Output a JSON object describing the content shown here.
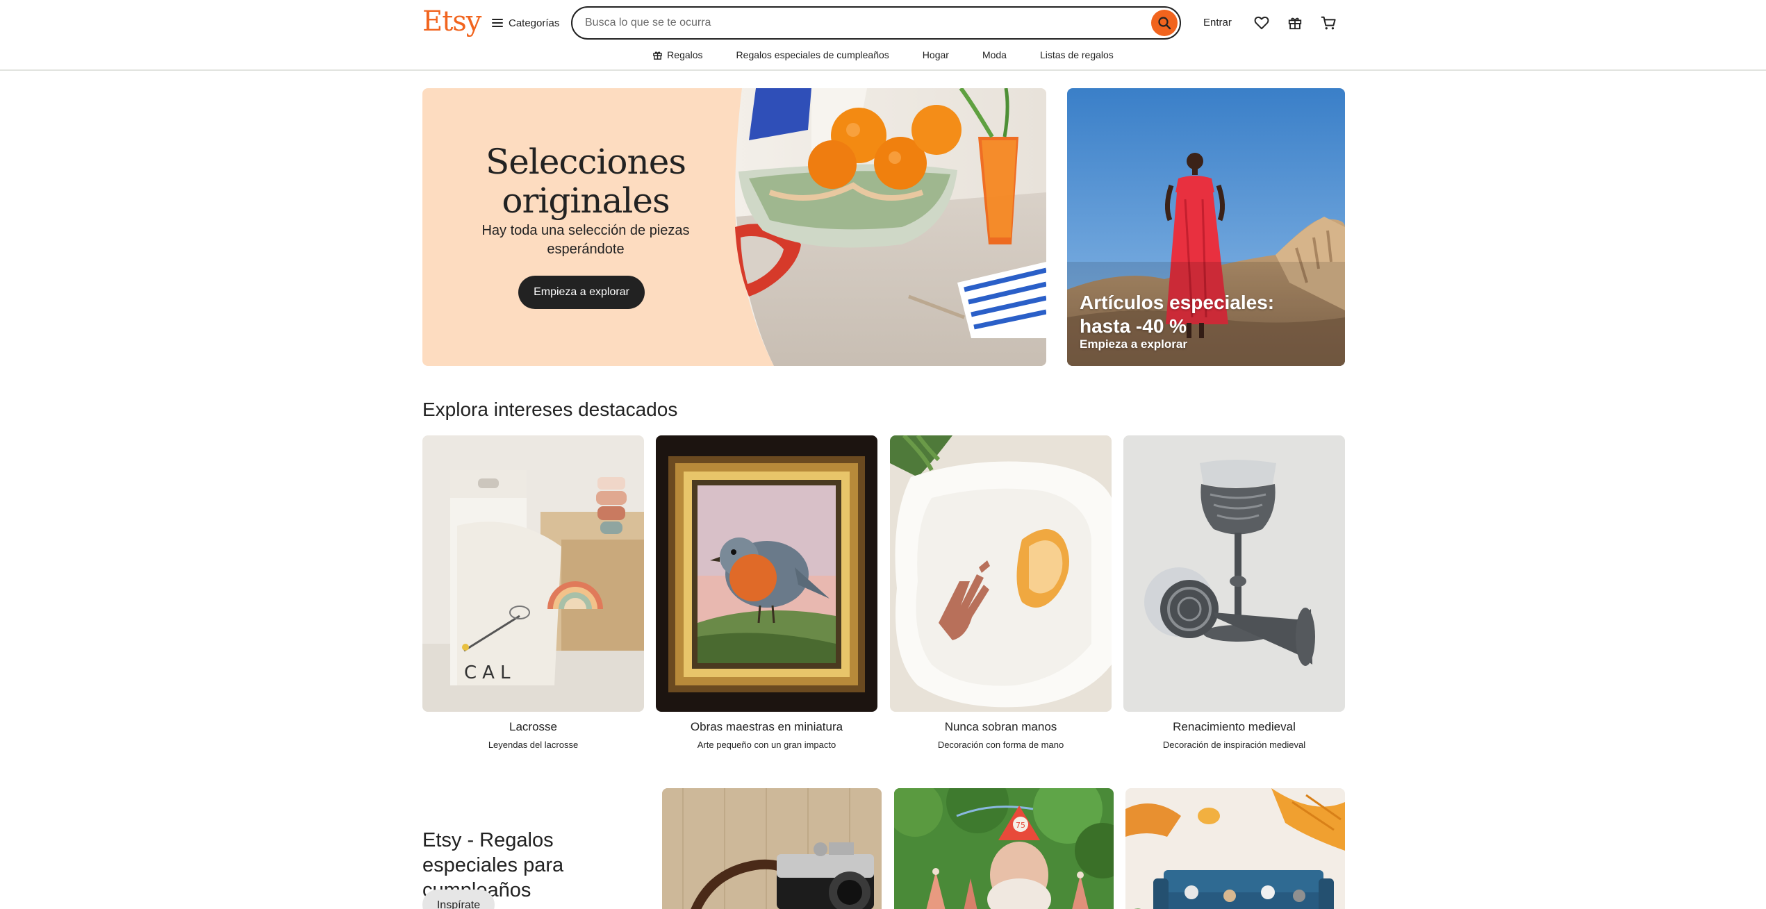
{
  "header": {
    "logo": "Etsy",
    "categories_label": "Categorías",
    "search_placeholder": "Busca lo que se te ocurra",
    "signin_label": "Entrar",
    "icons": [
      "menu-icon",
      "search-icon",
      "heart-icon",
      "gift-icon",
      "cart-icon"
    ]
  },
  "subnav": {
    "items": [
      {
        "label": "Regalos",
        "icon": "gift-icon"
      },
      {
        "label": "Regalos especiales de cumpleaños"
      },
      {
        "label": "Hogar"
      },
      {
        "label": "Moda"
      },
      {
        "label": "Listas de regalos"
      }
    ]
  },
  "hero": {
    "title": "Selecciones originales",
    "subtitle": "Hay toda una selección de piezas esperándote",
    "button_label": "Empieza a explorar"
  },
  "side_promo": {
    "title": "Artículos especiales: hasta -40 %",
    "link_label": "Empieza a explorar"
  },
  "interests": {
    "title": "Explora intereses destacados",
    "cards": [
      {
        "title": "Lacrosse",
        "subtitle": "Leyendas del lacrosse"
      },
      {
        "title": "Obras maestras en miniatura",
        "subtitle": "Arte pequeño con un gran impacto"
      },
      {
        "title": "Nunca sobran manos",
        "subtitle": "Decoración con forma de mano"
      },
      {
        "title": "Renacimiento medieval",
        "subtitle": "Decoración de inspiración medieval"
      }
    ]
  },
  "birthday": {
    "title": "Etsy - Regalos especiales para cumpleaños",
    "button_label": "Inspírate"
  },
  "colors": {
    "brand": "#f1641e",
    "hero_bg": "#fddcc0",
    "text": "#222222",
    "button_dark": "#222222",
    "sky_blue": "#4a8fd0",
    "dress_red": "#e8303f"
  }
}
